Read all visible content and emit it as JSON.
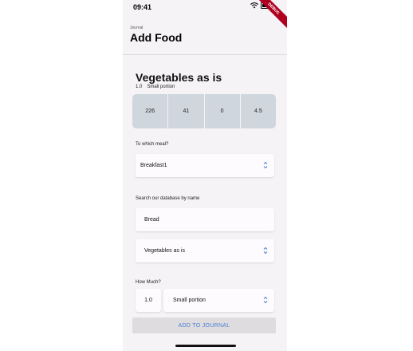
{
  "status": {
    "time": "09:41"
  },
  "debug_ribbon": "DEBUG",
  "header": {
    "breadcrumb": "Journal",
    "title": "Add Food"
  },
  "food": {
    "name": "Vegetables as is",
    "quantity": "1.0",
    "portion": "Small portion",
    "macros": [
      "226",
      "41",
      "0",
      "4.5"
    ]
  },
  "meal": {
    "label": "To which meal?",
    "selected": "Breakfast1"
  },
  "search": {
    "label": "Search our database by name",
    "value": "Bread",
    "result_selected": "Vegetables as is"
  },
  "amount": {
    "label": "How Much?",
    "quantity": "1.0",
    "unit_selected": "Small portion"
  },
  "actions": {
    "add_label": "ADD TO JOURNAL"
  },
  "colors": {
    "accent": "#4a7fd4",
    "macro_bg": "#cfd6de",
    "debug": "#b00020"
  }
}
